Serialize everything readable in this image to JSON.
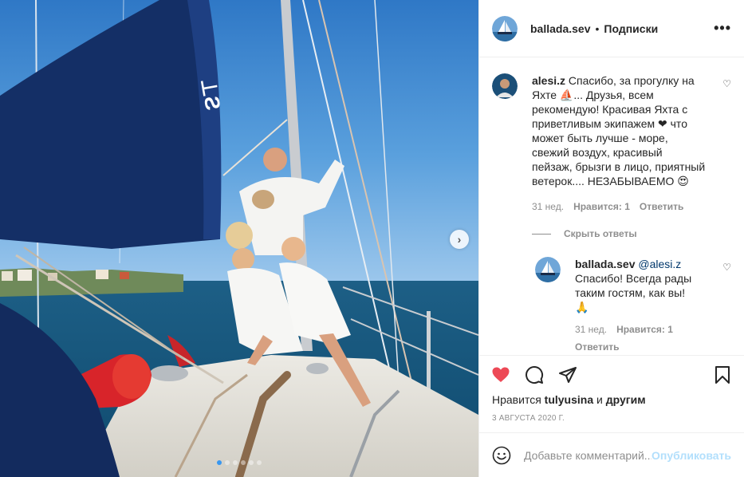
{
  "post": {
    "author": "ballada.sev",
    "separator": "•",
    "follow_label": "Подписки",
    "more_label": "•••"
  },
  "photo": {
    "next_label": "›",
    "slide_count": 6,
    "active_slide": 1
  },
  "comment": {
    "user": "alesi.z",
    "text": "Спасибо, за прогулку на Яхте ⛵... Друзья, всем рекомендую! Красивая Яхта с приветливым экипажем ❤ что может быть лучше - море, свежий воздух, красивый пейзаж, брызги в лицо, приятный ветерок.... НЕЗАБЫВАЕМО 😍",
    "age": "31 нед.",
    "likes": "Нравится: 1",
    "reply_label": "Ответить"
  },
  "hide_replies_label": "Скрыть ответы",
  "reply": {
    "user": "ballada.sev",
    "mention": "@alesi.z",
    "text": "Спасибо! Всегда рады таким гостям, как вы!🙏",
    "age": "31 нед.",
    "likes": "Нравится: 1",
    "reply_label": "Ответить"
  },
  "likes_line": {
    "prefix": "Нравится",
    "user": "tulyusina",
    "middle": "и",
    "others": "другим"
  },
  "date": "3 августа 2020 г.",
  "add_comment": {
    "placeholder": "Добавьте комментарий...",
    "publish_label": "Опубликовать"
  },
  "colors": {
    "like_active": "#ed4956",
    "link_blue": "#00376b",
    "publish_disabled": "#b2dffc",
    "dot_active": "#3897f0"
  },
  "icons": [
    "heart-icon",
    "comment-icon",
    "share-icon",
    "bookmark-icon",
    "emoji-icon",
    "more-icon",
    "chevron-right-icon"
  ]
}
